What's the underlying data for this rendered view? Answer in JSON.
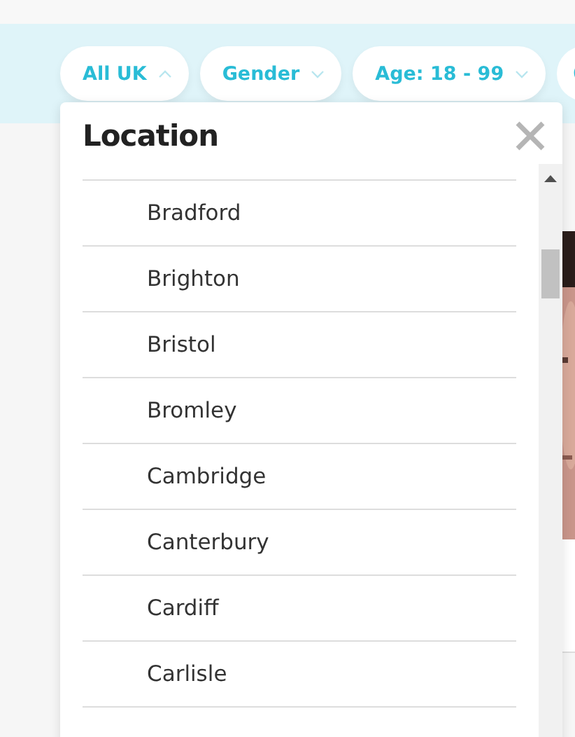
{
  "filters": [
    {
      "label": "All UK",
      "expanded": true
    },
    {
      "label": "Gender",
      "expanded": false
    },
    {
      "label": "Age: 18 - 99",
      "expanded": false
    }
  ],
  "location_panel": {
    "title": "Location",
    "items": [
      "Bradford",
      "Brighton",
      "Bristol",
      "Bromley",
      "Cambridge",
      "Canterbury",
      "Cardiff",
      "Carlisle"
    ]
  }
}
